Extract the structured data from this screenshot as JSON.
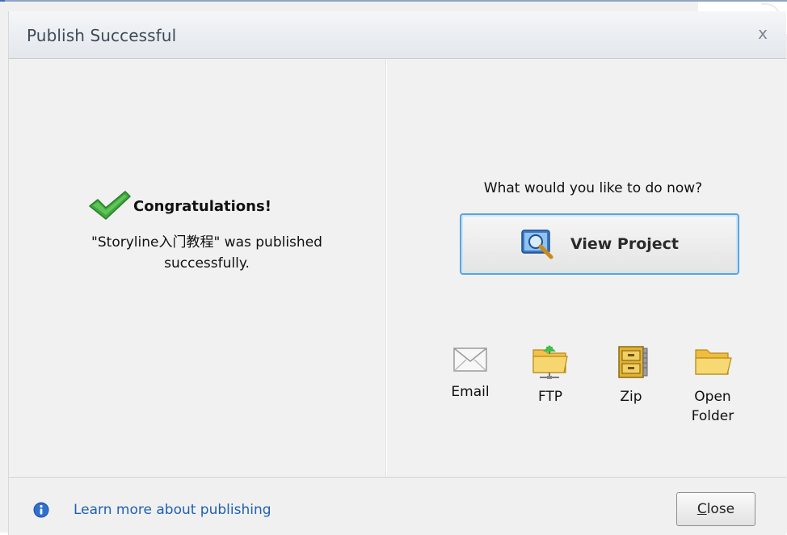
{
  "dialog": {
    "title": "Publish Successful",
    "close_glyph": "x"
  },
  "left": {
    "heading": "Congratulations!",
    "message_line1": "\"Storyline入门教程\" was published",
    "message_line2": "successfully.",
    "icon": "checkmark-icon"
  },
  "right": {
    "question": "What would you like to do now?",
    "view_project": {
      "label": "View Project",
      "icon": "magnifier-icon"
    },
    "actions": [
      {
        "label": "Email",
        "icon": "envelope-icon"
      },
      {
        "label": "FTP",
        "icon": "ftp-folder-icon"
      },
      {
        "label": "Zip",
        "icon": "zip-cabinet-icon"
      },
      {
        "label_line1": "Open",
        "label_line2": "Folder",
        "icon": "folder-icon"
      }
    ]
  },
  "footer": {
    "learn_more": "Learn more about publishing",
    "close_first": "C",
    "close_rest": "lose"
  },
  "colors": {
    "link": "#1f5fb5",
    "accent_border": "#5fa4dc",
    "check_green": "#3daa3a"
  }
}
